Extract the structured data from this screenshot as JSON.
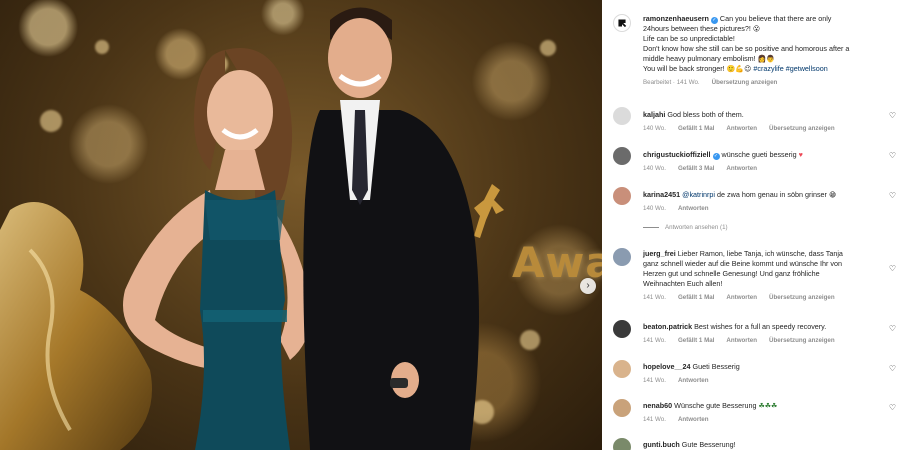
{
  "photo": {
    "award_text": "Awa",
    "next_arrow": "›"
  },
  "post": {
    "username": "ramonzenhaeusern",
    "caption_line1": "Can you believe that there are only",
    "caption_line2": "24hours between these pictures?!",
    "caption_line3": "Life can be so unpredictable!",
    "caption_line4": "Don't know how she still can be so positive and homorous after a",
    "caption_line5": "middle heavy pulmonary embolism!",
    "caption_line6": "You will be back stronger!",
    "hashtag1": "#crazylife",
    "hashtag2": "#getwellsoon",
    "meta_edited": "Bearbeitet · 141 Wo.",
    "meta_translate": "Übersetzung anzeigen"
  },
  "comments": [
    {
      "username": "kaljahi",
      "text": "God bless both of them.",
      "time": "140 Wo.",
      "likes": "Gefällt 1 Mal",
      "reply": "Antworten",
      "translate": "Übersetzung anzeigen",
      "avatar_color": "#dbdbdb"
    },
    {
      "username": "chrigustuckioffiziell",
      "text": "wünsche gueti besserig",
      "time": "140 Wo.",
      "likes": "Gefällt 3 Mal",
      "reply": "Antworten",
      "avatar_color": "#6b6b6b"
    },
    {
      "username": "karina2451",
      "mention": "@katrinrpi",
      "text": "de zwa hom genau in söbn grinser",
      "time": "140 Wo.",
      "reply": "Antworten",
      "view_replies": "Antworten ansehen (1)",
      "avatar_color": "#c98f7a"
    },
    {
      "username": "juerg_frei",
      "text_line1": "Lieber Ramon, liebe Tanja, ich wünsche, dass Tanja",
      "text_line2": "ganz schnell wieder auf die Beine kommt und wünsche Ihr von",
      "text_line3": "Herzen gut und schnelle Genesung! Und ganz fröhliche",
      "text_line4": "Weihnachten Euch allen!",
      "time": "141 Wo.",
      "likes": "Gefällt 1 Mal",
      "reply": "Antworten",
      "translate": "Übersetzung anzeigen",
      "avatar_color": "#8a9bb0"
    },
    {
      "username": "beaton.patrick",
      "text": "Best wishes for a full an speedy recovery.",
      "time": "141 Wo.",
      "likes": "Gefällt 1 Mal",
      "reply": "Antworten",
      "translate": "Übersetzung anzeigen",
      "avatar_color": "#3a3a3a"
    },
    {
      "username": "hopelove__24",
      "text": "Gueti Besserig",
      "time": "141 Wo.",
      "reply": "Antworten",
      "avatar_color": "#d9b38c"
    },
    {
      "username": "nenab60",
      "text": "Wünsche gute Besserung",
      "time": "141 Wo.",
      "reply": "Antworten",
      "avatar_color": "#c9a27a"
    },
    {
      "username": "gunti.buch",
      "text": "Gute Besserung!",
      "avatar_color": "#7a8a6a"
    }
  ],
  "colors": {
    "link": "#00376b",
    "verified": "#3897f0",
    "muted": "#8e8e8e",
    "heart_red": "#ed4956"
  }
}
